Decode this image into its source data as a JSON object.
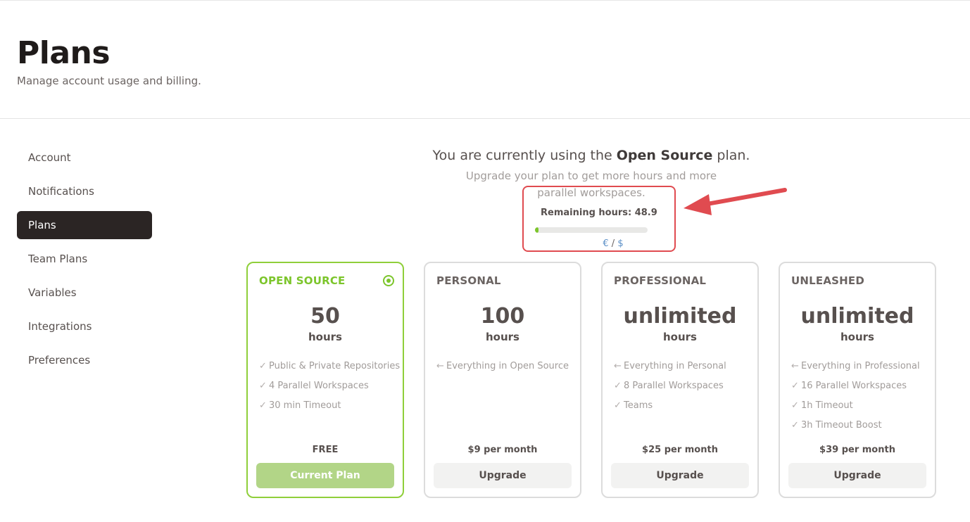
{
  "header": {
    "title": "Plans",
    "subtitle": "Manage account usage and billing."
  },
  "sidebar": {
    "items": [
      {
        "label": "Account"
      },
      {
        "label": "Notifications"
      },
      {
        "label": "Plans",
        "active": true
      },
      {
        "label": "Team Plans"
      },
      {
        "label": "Variables"
      },
      {
        "label": "Integrations"
      },
      {
        "label": "Preferences"
      }
    ]
  },
  "hero": {
    "line1_prefix": "You are currently using the",
    "plan_name": "Open Source",
    "line1_suffix": "plan.",
    "line2": "Upgrade your plan to get more hours and more parallel workspaces."
  },
  "usage": {
    "remaining_label": "Remaining hours: 48.9",
    "remaining_fraction": 0.03,
    "currency_euro": "€",
    "currency_sep": " / ",
    "currency_dollar": "$"
  },
  "plans": [
    {
      "name": "OPEN SOURCE",
      "amount": "50",
      "unit": "hours",
      "selected": true,
      "features": [
        {
          "mark": "✓",
          "text": "Public & Private Repositories"
        },
        {
          "mark": "✓",
          "text": "4 Parallel Workspaces"
        },
        {
          "mark": "✓",
          "text": "30 min Timeout"
        }
      ],
      "price": "FREE",
      "button": "Current Plan"
    },
    {
      "name": "PERSONAL",
      "amount": "100",
      "unit": "hours",
      "selected": false,
      "features": [
        {
          "mark": "←",
          "text": "Everything in Open Source"
        }
      ],
      "price": "$9 per month",
      "button": "Upgrade"
    },
    {
      "name": "PROFESSIONAL",
      "amount": "unlimited",
      "unit": "hours",
      "selected": false,
      "features": [
        {
          "mark": "←",
          "text": "Everything in Personal"
        },
        {
          "mark": "✓",
          "text": "8 Parallel Workspaces"
        },
        {
          "mark": "✓",
          "text": "Teams"
        }
      ],
      "price": "$25 per month",
      "button": "Upgrade"
    },
    {
      "name": "UNLEASHED",
      "amount": "unlimited",
      "unit": "hours",
      "selected": false,
      "features": [
        {
          "mark": "←",
          "text": "Everything in Professional"
        },
        {
          "mark": "✓",
          "text": "16 Parallel Workspaces"
        },
        {
          "mark": "✓",
          "text": "1h Timeout"
        },
        {
          "mark": "✓",
          "text": "3h Timeout Boost"
        }
      ],
      "price": "$39 per month",
      "button": "Upgrade"
    }
  ],
  "colors": {
    "accent_green": "#7cc52b",
    "annotation_red": "#e04b50",
    "active_nav_bg": "#2b2524"
  }
}
